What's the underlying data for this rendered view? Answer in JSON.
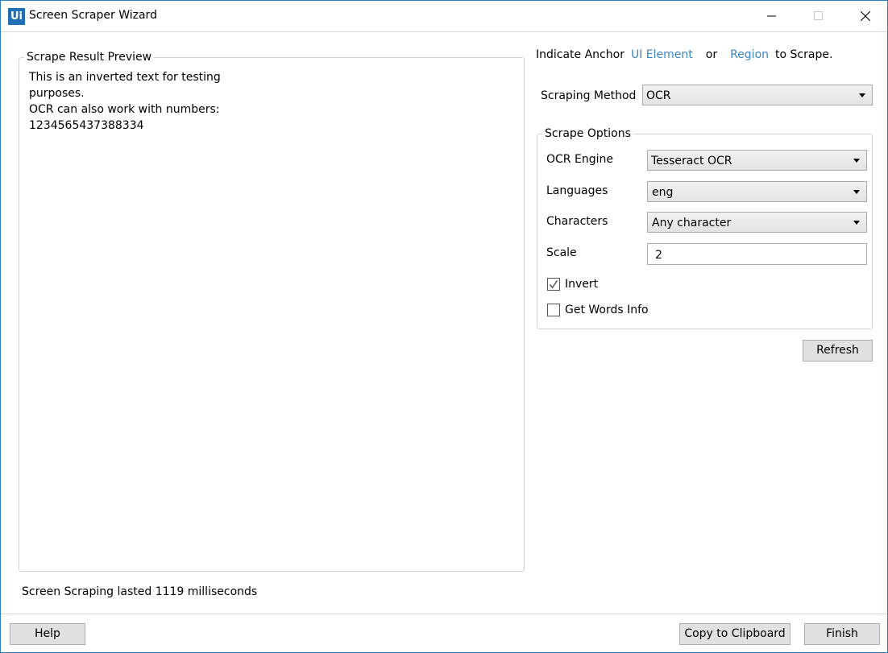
{
  "window": {
    "title": "Screen Scraper Wizard",
    "icon_text": "Ui"
  },
  "preview": {
    "label": "Scrape Result Preview",
    "text": "This is an inverted text for testing\npurposes.\nOCR can also work with numbers:\n1234565437388334"
  },
  "status": "Screen Scraping lasted 1119 milliseconds",
  "anchor": {
    "prefix": "Indicate Anchor",
    "ui_element_link": "UI Element",
    "or": "or",
    "region_link": "Region",
    "suffix": "to Scrape."
  },
  "scraping_method": {
    "label": "Scraping Method",
    "value": "OCR"
  },
  "scrape_options": {
    "label": "Scrape Options",
    "ocr_engine": {
      "label": "OCR Engine",
      "value": "Tesseract OCR"
    },
    "languages": {
      "label": "Languages",
      "value": "eng"
    },
    "characters": {
      "label": "Characters",
      "value": "Any character"
    },
    "scale": {
      "label": "Scale",
      "value": "2"
    },
    "invert": {
      "label": "Invert",
      "checked": true
    },
    "get_words_info": {
      "label": "Get Words Info",
      "checked": false
    }
  },
  "buttons": {
    "refresh": "Refresh",
    "help": "Help",
    "copy": "Copy to Clipboard",
    "finish": "Finish"
  },
  "colors": {
    "link": "#3d85c6",
    "accent": "#1f6fb5"
  }
}
